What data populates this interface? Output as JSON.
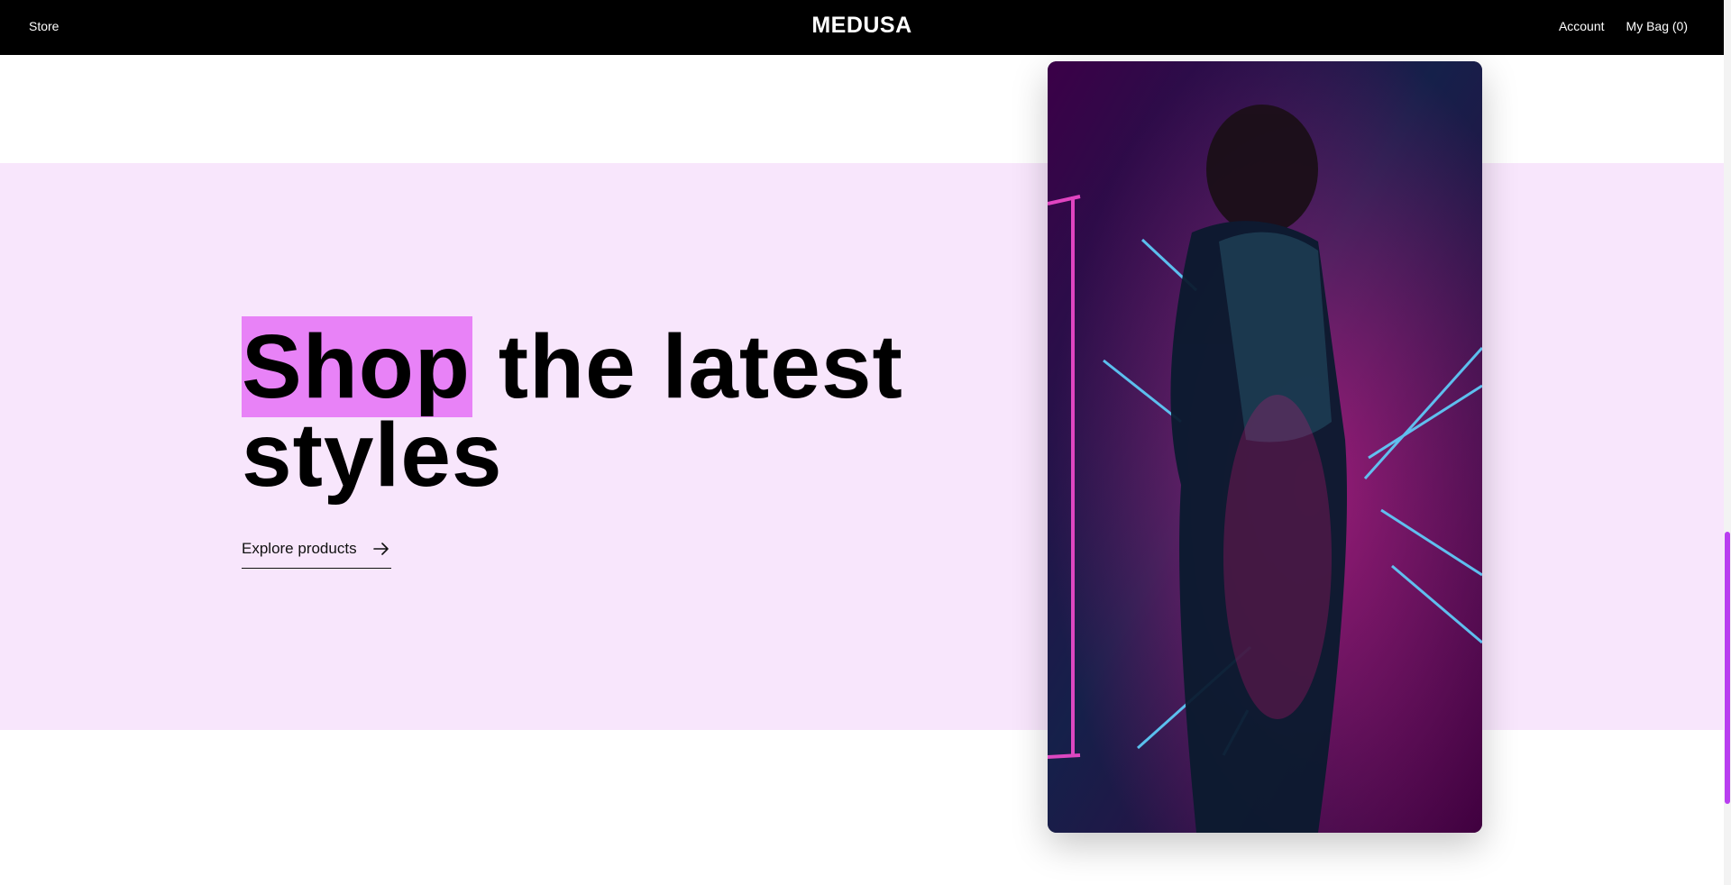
{
  "nav": {
    "store": "Store",
    "brand": "MEDUSA",
    "account": "Account",
    "bag": "My Bag (0)"
  },
  "hero": {
    "highlight_word": "Shop",
    "headline_rest": " the latest styles",
    "cta_label": "Explore products",
    "band_color": "#f8e6fc",
    "highlight_color": "#e882f7"
  },
  "media": {
    "alt": "video"
  },
  "icons": {
    "cta": "arrow-right-icon"
  }
}
